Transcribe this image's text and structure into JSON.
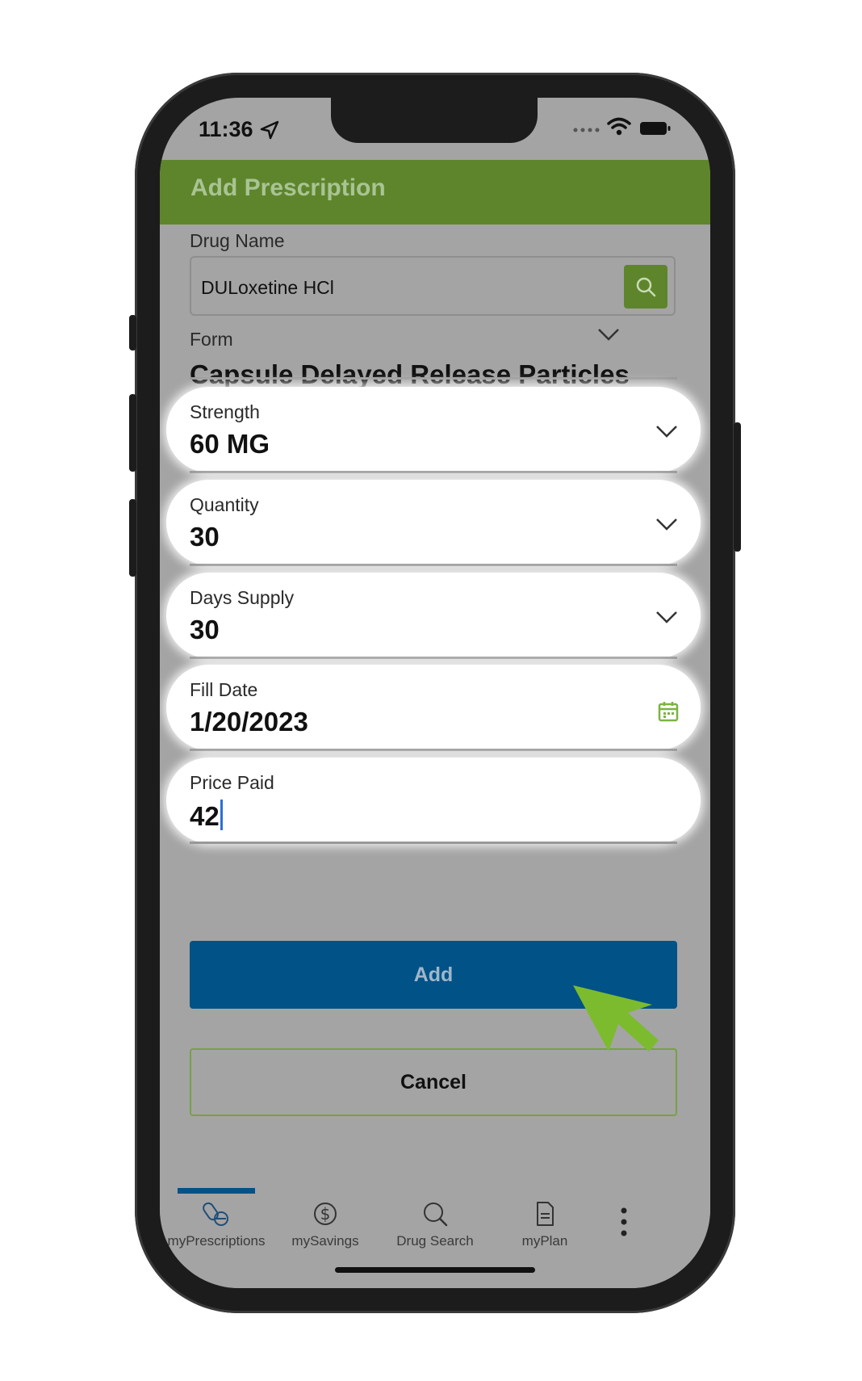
{
  "status_bar": {
    "time": "11:36"
  },
  "header": {
    "title": "Add Prescription"
  },
  "drug": {
    "label": "Drug Name",
    "value": "DULoxetine HCl"
  },
  "form": {
    "label": "Form",
    "value": "Capsule Delayed Release Particles"
  },
  "fields": [
    {
      "label": "Strength",
      "value": "60 MG"
    },
    {
      "label": "Quantity",
      "value": "30"
    },
    {
      "label": "Days Supply",
      "value": "30"
    },
    {
      "label": "Fill Date",
      "value": "1/20/2023"
    },
    {
      "label": "Price Paid",
      "value": "42"
    }
  ],
  "buttons": {
    "add": "Add",
    "cancel": "Cancel"
  },
  "tabs": [
    {
      "label": "myPrescriptions",
      "icon": "pills-icon",
      "active": true
    },
    {
      "label": "mySavings",
      "icon": "dollar-icon",
      "active": false
    },
    {
      "label": "Drug Search",
      "icon": "search-icon",
      "active": false
    },
    {
      "label": "myPlan",
      "icon": "document-icon",
      "active": false
    }
  ],
  "colors": {
    "header_green": "#5e852c",
    "primary_blue": "#015286",
    "accent_green": "#78a049",
    "overlay_gray": "#a4a4a4"
  }
}
